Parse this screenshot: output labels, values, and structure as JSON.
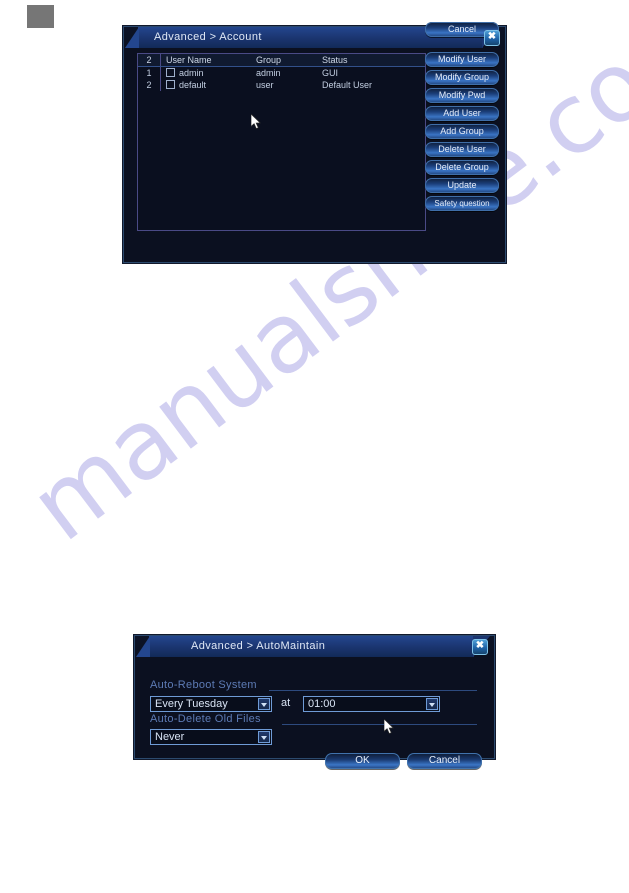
{
  "page": {
    "background": "#ffffff",
    "watermark_text": "manualshive.com",
    "watermark_color": "#c9c7ef"
  },
  "corner_block": {
    "color": "#767676"
  },
  "account_dialog": {
    "title": "Advanced > Account",
    "close_icon": "close-icon",
    "close_glyph": "✖",
    "table": {
      "headers": {
        "count": "2",
        "user_name": "User Name",
        "group": "Group",
        "status": "Status"
      },
      "rows": [
        {
          "index": "1",
          "user_name": "admin",
          "group": "admin",
          "status": "GUI",
          "checked": false
        },
        {
          "index": "2",
          "user_name": "default",
          "group": "user",
          "status": "Default User",
          "checked": false
        }
      ]
    },
    "buttons": [
      {
        "label": "Modify User"
      },
      {
        "label": "Modify Group"
      },
      {
        "label": "Modify Pwd"
      },
      {
        "label": "Add User"
      },
      {
        "label": "Add Group"
      },
      {
        "label": "Delete User"
      },
      {
        "label": "Delete Group"
      },
      {
        "label": "Update"
      },
      {
        "label": "Safety question"
      }
    ],
    "cancel_label": "Cancel"
  },
  "automaintain_dialog": {
    "title": "Advanced > AutoMaintain",
    "close_icon": "close-icon",
    "close_glyph": "✖",
    "reboot_section_label": "Auto-Reboot System",
    "reboot_day_value": "Every Tuesday",
    "at_label": "at",
    "reboot_time_value": "01:00",
    "delete_section_label": "Auto-Delete Old Files",
    "delete_value": "Never",
    "ok_label": "OK",
    "cancel_label": "Cancel"
  }
}
